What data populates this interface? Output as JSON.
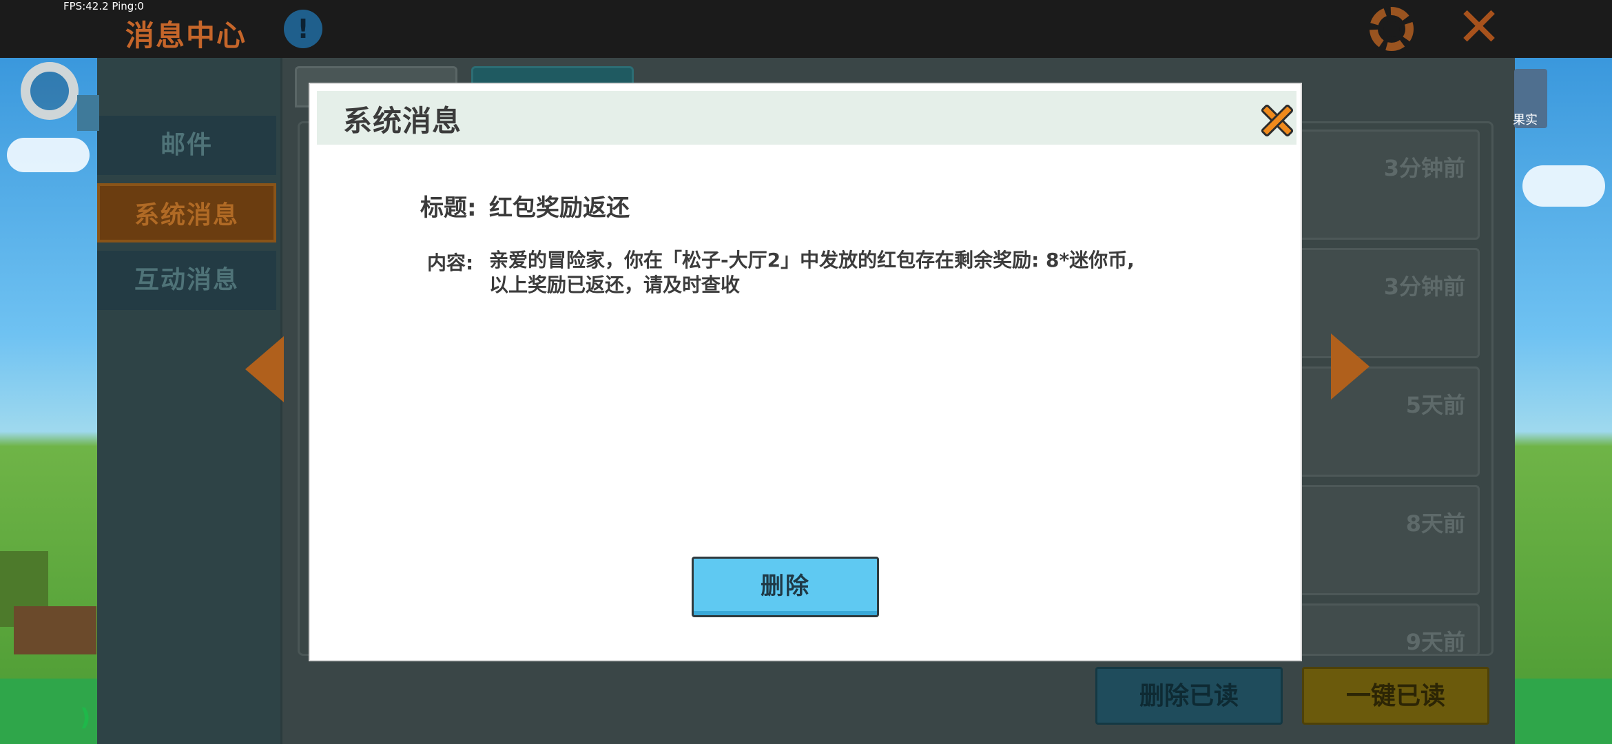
{
  "status": {
    "fps": "FPS:42.2  Ping:0"
  },
  "header": {
    "title": "消息中心",
    "help_icon_glyph": "!"
  },
  "sidebar": {
    "items": [
      {
        "label": "邮件",
        "active": false
      },
      {
        "label": "系统消息",
        "active": true
      },
      {
        "label": "互动消息",
        "active": false
      }
    ]
  },
  "list": {
    "times": [
      "3分钟前",
      "3分钟前",
      "5天前",
      "8天前",
      "9天前"
    ]
  },
  "footer": {
    "delete_read_label": "删除已读",
    "read_all_label": "一键已读"
  },
  "right_icon_label": "果实",
  "modal": {
    "title": "系统消息",
    "subject_label": "标题:",
    "subject": "红包奖励返还",
    "content_label": "内容:",
    "content_lines": [
      "亲爱的冒险家，你在「松子-大厅2」中发放的红包存在剩余奖励: 8*迷你币,",
      "以上奖励已返还，请及时查收"
    ],
    "delete_label": "删除"
  },
  "colors": {
    "accent_orange": "#f08a1c",
    "button_blue": "#5fc9f2",
    "header_bg": "#e5efe9",
    "text_dark": "#3b3b3b"
  }
}
